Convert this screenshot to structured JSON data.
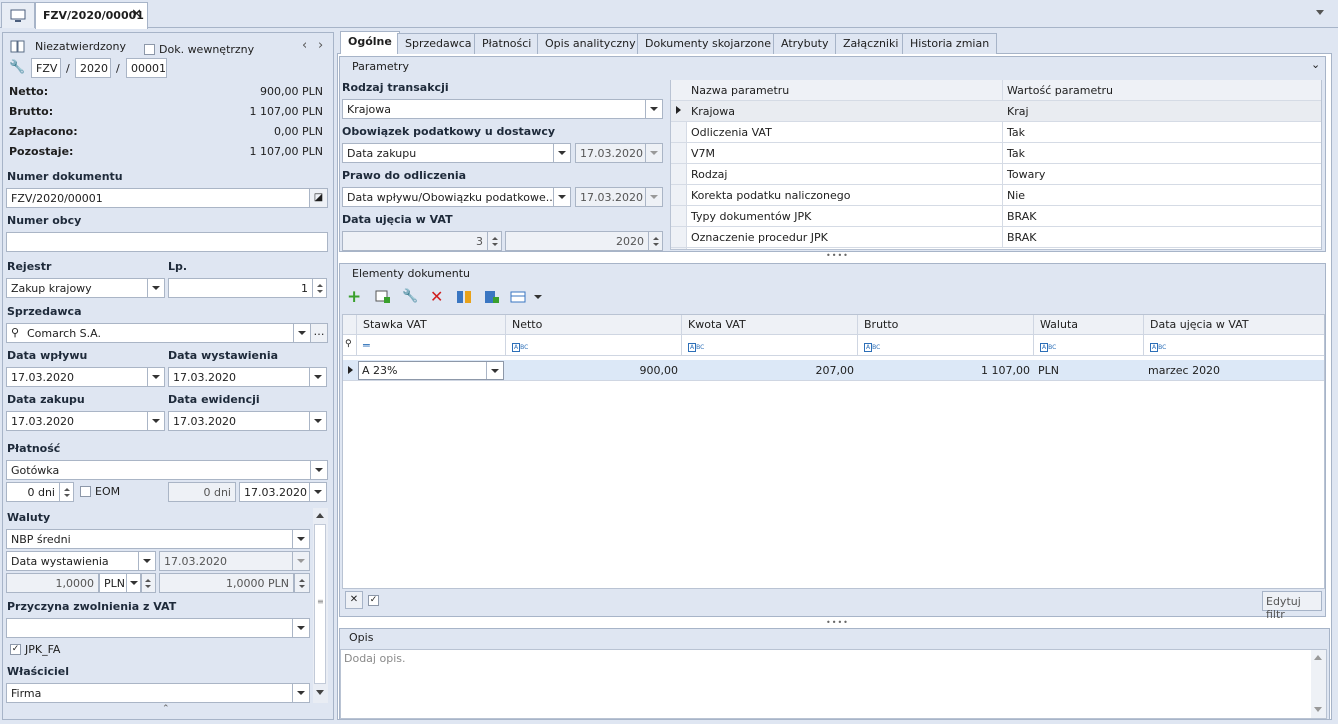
{
  "doc_tab": {
    "title": "FZV/2020/00001"
  },
  "header": {
    "status": "Niezatwierdzony",
    "internal_doc_label": "Dok. wewnętrzny",
    "prefix": "FZV",
    "year": "2020",
    "number": "00001",
    "sep": "/"
  },
  "totals": [
    {
      "label": "Netto:",
      "value": "900,00 PLN"
    },
    {
      "label": "Brutto:",
      "value": "1 107,00 PLN"
    },
    {
      "label": "Zapłacono:",
      "value": "0,00 PLN"
    },
    {
      "label": "Pozostaje:",
      "value": "1 107,00 PLN"
    }
  ],
  "left": {
    "doc_number_label": "Numer dokumentu",
    "doc_number": "FZV/2020/00001",
    "foreign_number_label": "Numer obcy",
    "foreign_number": "",
    "register_label": "Rejestr",
    "register": "Zakup krajowy",
    "lp_label": "Lp.",
    "lp": "1",
    "seller_label": "Sprzedawca",
    "seller": "Comarch S.A.",
    "receipt_date_label": "Data wpływu",
    "receipt_date": "17.03.2020",
    "issue_date_label": "Data wystawienia",
    "issue_date": "17.03.2020",
    "purchase_date_label": "Data zakupu",
    "purchase_date": "17.03.2020",
    "record_date_label": "Data ewidencji",
    "record_date": "17.03.2020",
    "payment_label": "Płatność",
    "payment": "Gotówka",
    "days1": "0 dni",
    "eom_label": "EOM",
    "days2": "0 dni",
    "due_date": "17.03.2020",
    "currency_label": "Waluty",
    "rate_type": "NBP średni",
    "rate_date_type": "Data wystawienia",
    "rate_date": "17.03.2020",
    "rate1": "1,0000",
    "currency": "PLN",
    "rate2": "1,0000 PLN",
    "vat_exempt_label": "Przyczyna zwolnienia z VAT",
    "vat_exempt": "",
    "jpk_label": "JPK_FA",
    "owner_label": "Właściciel",
    "owner": "Firma"
  },
  "tabs": [
    "Ogólne",
    "Sprzedawca",
    "Płatności",
    "Opis analityczny",
    "Dokumenty skojarzone",
    "Atrybuty",
    "Załączniki",
    "Historia zmian"
  ],
  "params": {
    "section": "Parametry",
    "trans_type_label": "Rodzaj transakcji",
    "trans_type": "Krajowa",
    "tax_duty_label": "Obowiązek podatkowy u dostawcy",
    "tax_duty": "Data zakupu",
    "tax_duty_date": "17.03.2020",
    "deduct_label": "Prawo do odliczenia",
    "deduct": "Data wpływu/Obowiązku podatkowe...",
    "deduct_date": "17.03.2020",
    "vat_date_label": "Data ujęcia w VAT",
    "vat_month": "3",
    "vat_year": "2020",
    "grid_headers": [
      "Nazwa parametru",
      "Wartość parametru"
    ],
    "grid_rows": [
      [
        "Krajowa",
        "Kraj"
      ],
      [
        "Odliczenia VAT",
        "Tak"
      ],
      [
        "V7M",
        "Tak"
      ],
      [
        "Rodzaj",
        "Towary"
      ],
      [
        "Korekta podatku naliczonego",
        "Nie"
      ],
      [
        "Typy dokumentów JPK",
        "BRAK"
      ],
      [
        "Oznaczenie procedur JPK",
        "BRAK"
      ]
    ]
  },
  "elements": {
    "section": "Elementy dokumentu",
    "headers": [
      "Stawka VAT",
      "Netto",
      "Kwota VAT",
      "Brutto",
      "Waluta",
      "Data ujęcia w VAT"
    ],
    "rows": [
      [
        "A 23%",
        "900,00",
        "207,00",
        "1 107,00",
        "PLN",
        "marzec 2020"
      ]
    ],
    "edit_filter": "Edytuj filtr"
  },
  "desc": {
    "section": "Opis",
    "placeholder": "Dodaj opis."
  }
}
